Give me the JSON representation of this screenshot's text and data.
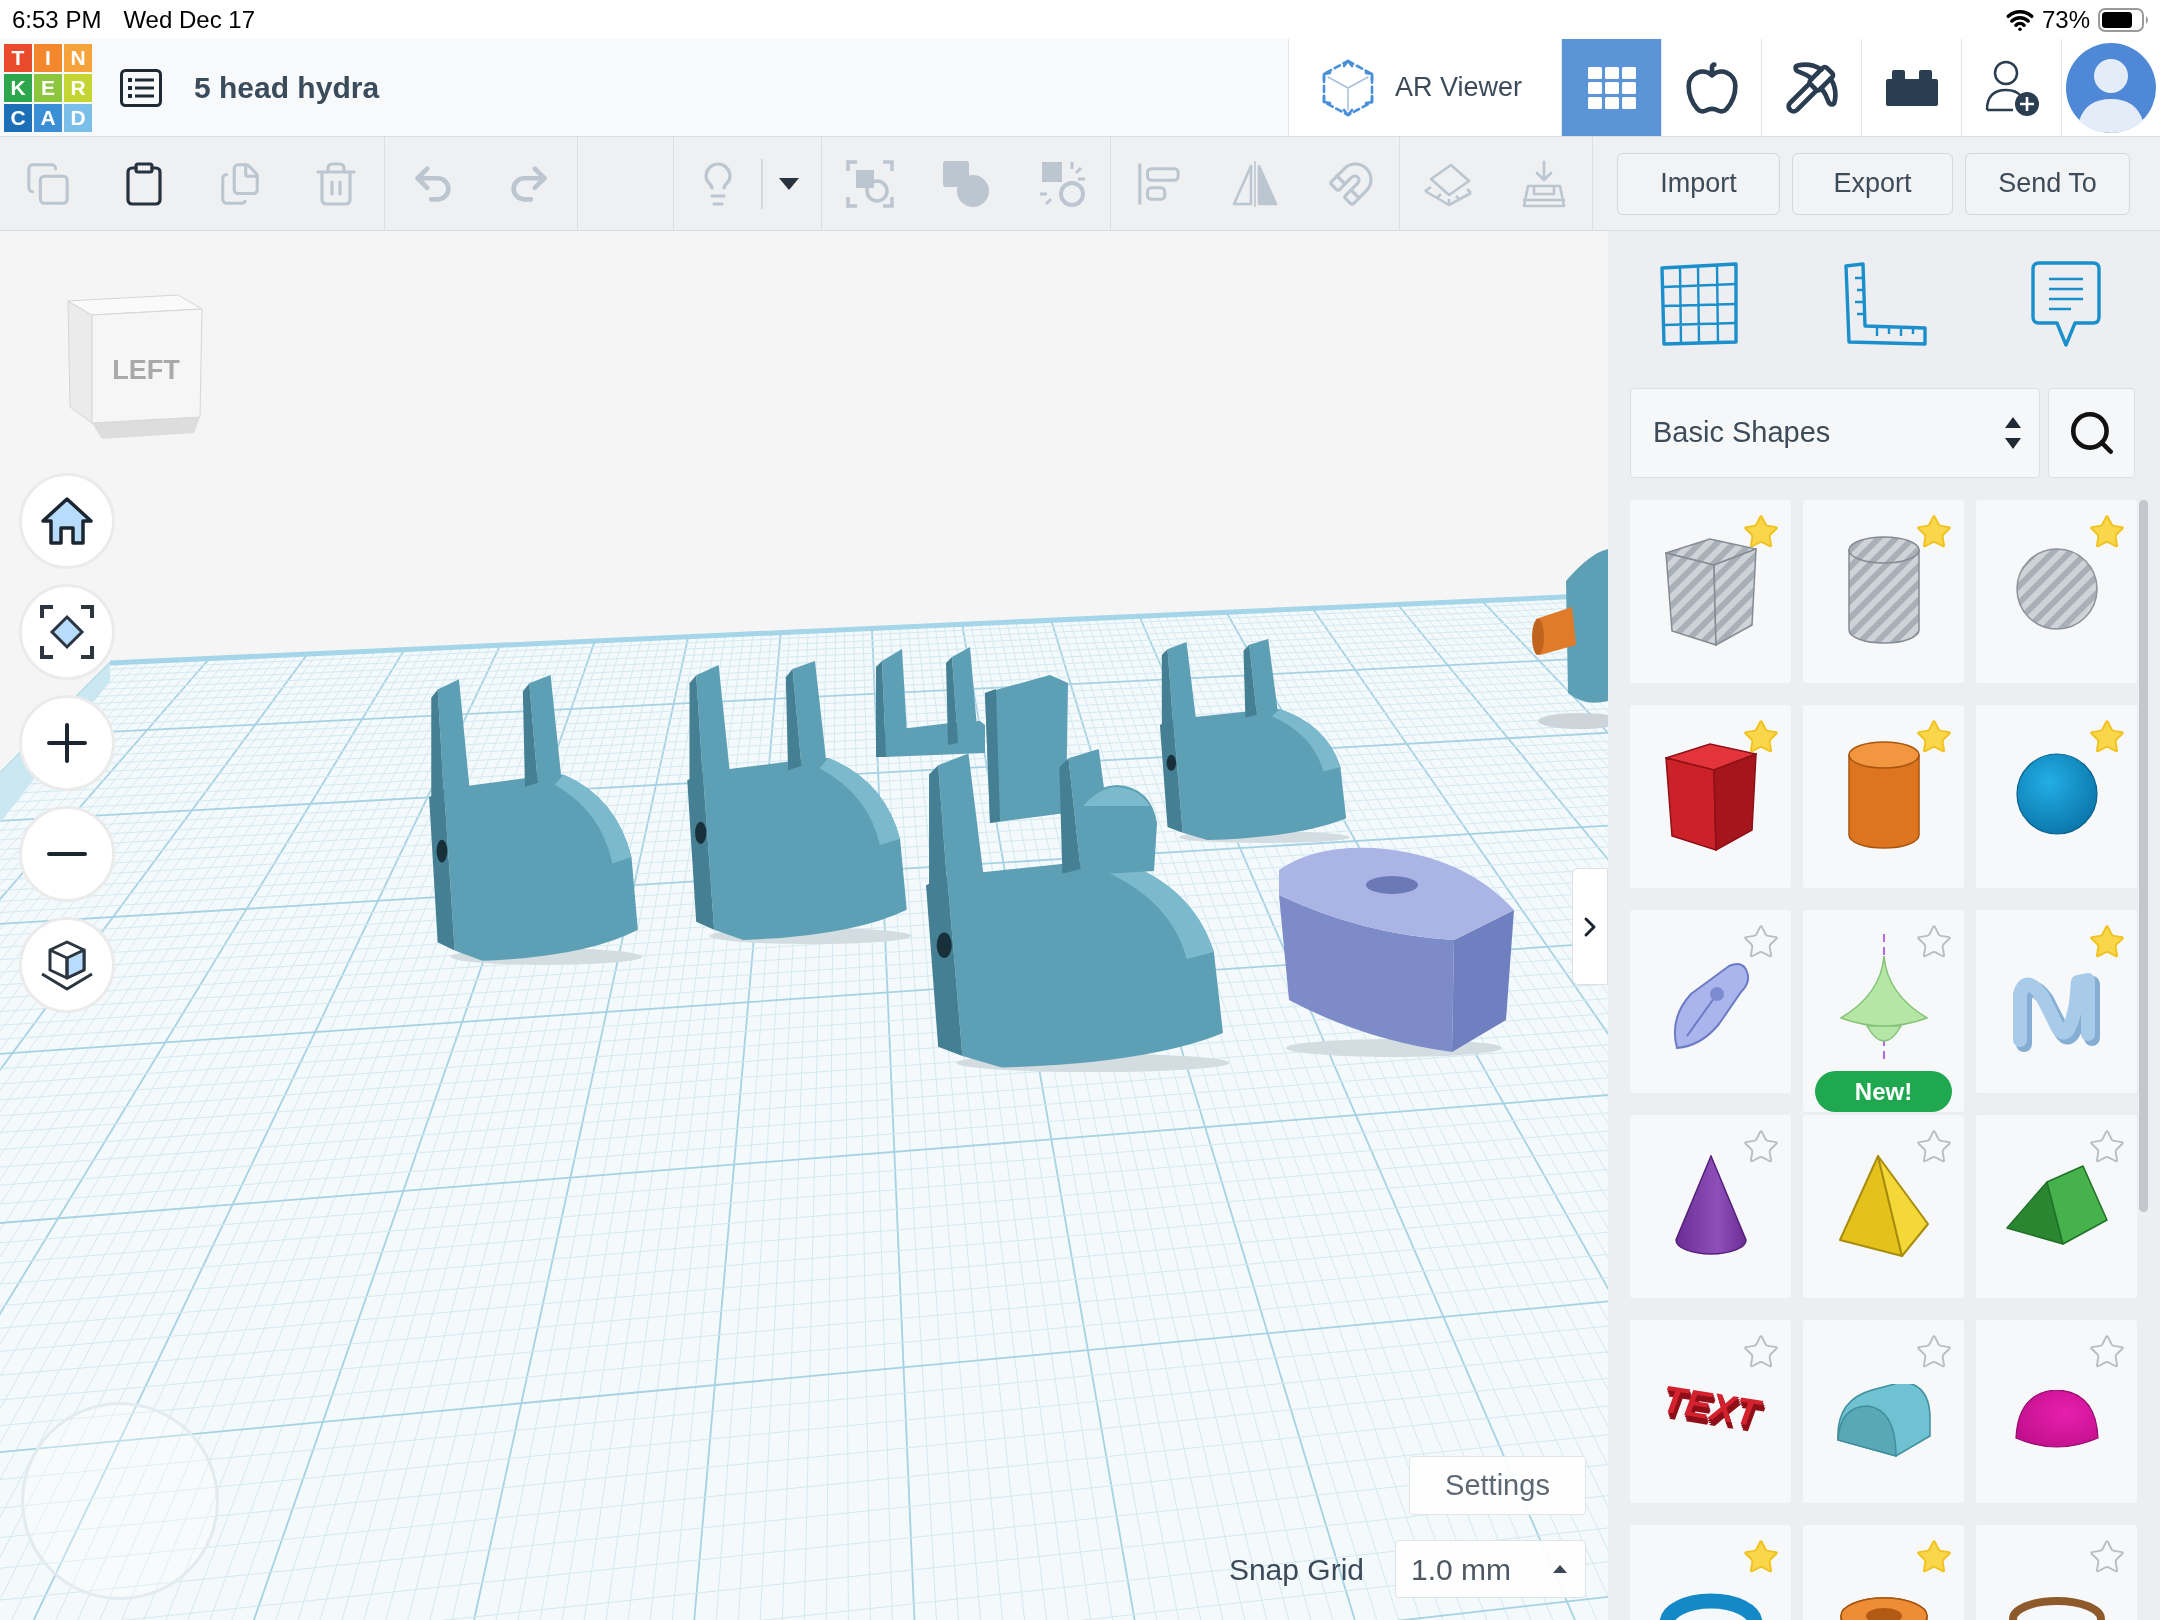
{
  "status_bar": {
    "time": "6:53 PM",
    "date": "Wed Dec 17",
    "battery": "73%"
  },
  "header": {
    "logo": [
      [
        "T",
        "I",
        "N"
      ],
      [
        "K",
        "E",
        "R"
      ],
      [
        "C",
        "A",
        "D"
      ]
    ],
    "title": "5 head hydra",
    "ar_viewer": "AR Viewer",
    "views": [
      {
        "kind": "design",
        "selected": true
      },
      {
        "kind": "sim",
        "selected": false
      },
      {
        "kind": "blocks",
        "selected": false
      },
      {
        "kind": "bricks",
        "selected": false
      }
    ]
  },
  "toolbar": {
    "groups": [
      [
        {
          "kind": "copy",
          "disabled": true
        },
        {
          "kind": "paste",
          "disabled": false
        },
        {
          "kind": "duplicate",
          "disabled": true
        },
        {
          "kind": "delete",
          "disabled": true
        }
      ],
      [
        {
          "kind": "undo",
          "disabled": true
        },
        {
          "kind": "redo",
          "disabled": true
        }
      ],
      [
        {
          "kind": "lightbulb",
          "disabled": true
        },
        {
          "kind": "menu",
          "disabled": false
        }
      ],
      [
        {
          "kind": "group",
          "disabled": true
        },
        {
          "kind": "solid",
          "disabled": true
        },
        {
          "kind": "hole",
          "disabled": true
        }
      ],
      [
        {
          "kind": "align",
          "disabled": true
        },
        {
          "kind": "mirror",
          "disabled": true
        },
        {
          "kind": "magnet",
          "disabled": true
        }
      ],
      [
        {
          "kind": "workplane",
          "disabled": true
        },
        {
          "kind": "drop",
          "disabled": true
        }
      ]
    ],
    "buttons": [
      "Import",
      "Export",
      "Send To"
    ]
  },
  "viewport": {
    "view_cube": "LEFT",
    "controls": [
      {
        "kind": "home"
      },
      {
        "kind": "fit"
      },
      {
        "kind": "zoom-in"
      },
      {
        "kind": "zoom-out"
      },
      {
        "kind": "projection"
      }
    ],
    "settings": "Settings",
    "snap_grid": {
      "label": "Snap Grid",
      "value": "1.0 mm"
    }
  },
  "panel": {
    "tools": [
      {
        "kind": "workplane"
      },
      {
        "kind": "ruler"
      },
      {
        "kind": "notes"
      }
    ],
    "library": "Basic Shapes",
    "shapes": [
      {
        "kind": "box-hole",
        "favorite": true
      },
      {
        "kind": "cylinder-hole",
        "favorite": true
      },
      {
        "kind": "sphere-hole",
        "favorite": true
      },
      {
        "kind": "box",
        "favorite": true
      },
      {
        "kind": "cylinder",
        "favorite": true
      },
      {
        "kind": "sphere",
        "favorite": true
      },
      {
        "kind": "scribble",
        "favorite": false
      },
      {
        "kind": "spin",
        "favorite": false,
        "badge": "New!"
      },
      {
        "kind": "waves",
        "favorite": true
      },
      {
        "kind": "cone",
        "favorite": false
      },
      {
        "kind": "pyramid",
        "favorite": false
      },
      {
        "kind": "roof",
        "favorite": false
      },
      {
        "kind": "text",
        "favorite": false,
        "text": "TEXT"
      },
      {
        "kind": "round-roof",
        "favorite": false
      },
      {
        "kind": "paraboloid",
        "favorite": false
      },
      {
        "kind": "torus",
        "favorite": true
      },
      {
        "kind": "tube",
        "favorite": true
      },
      {
        "kind": "ring",
        "favorite": false
      }
    ]
  }
}
